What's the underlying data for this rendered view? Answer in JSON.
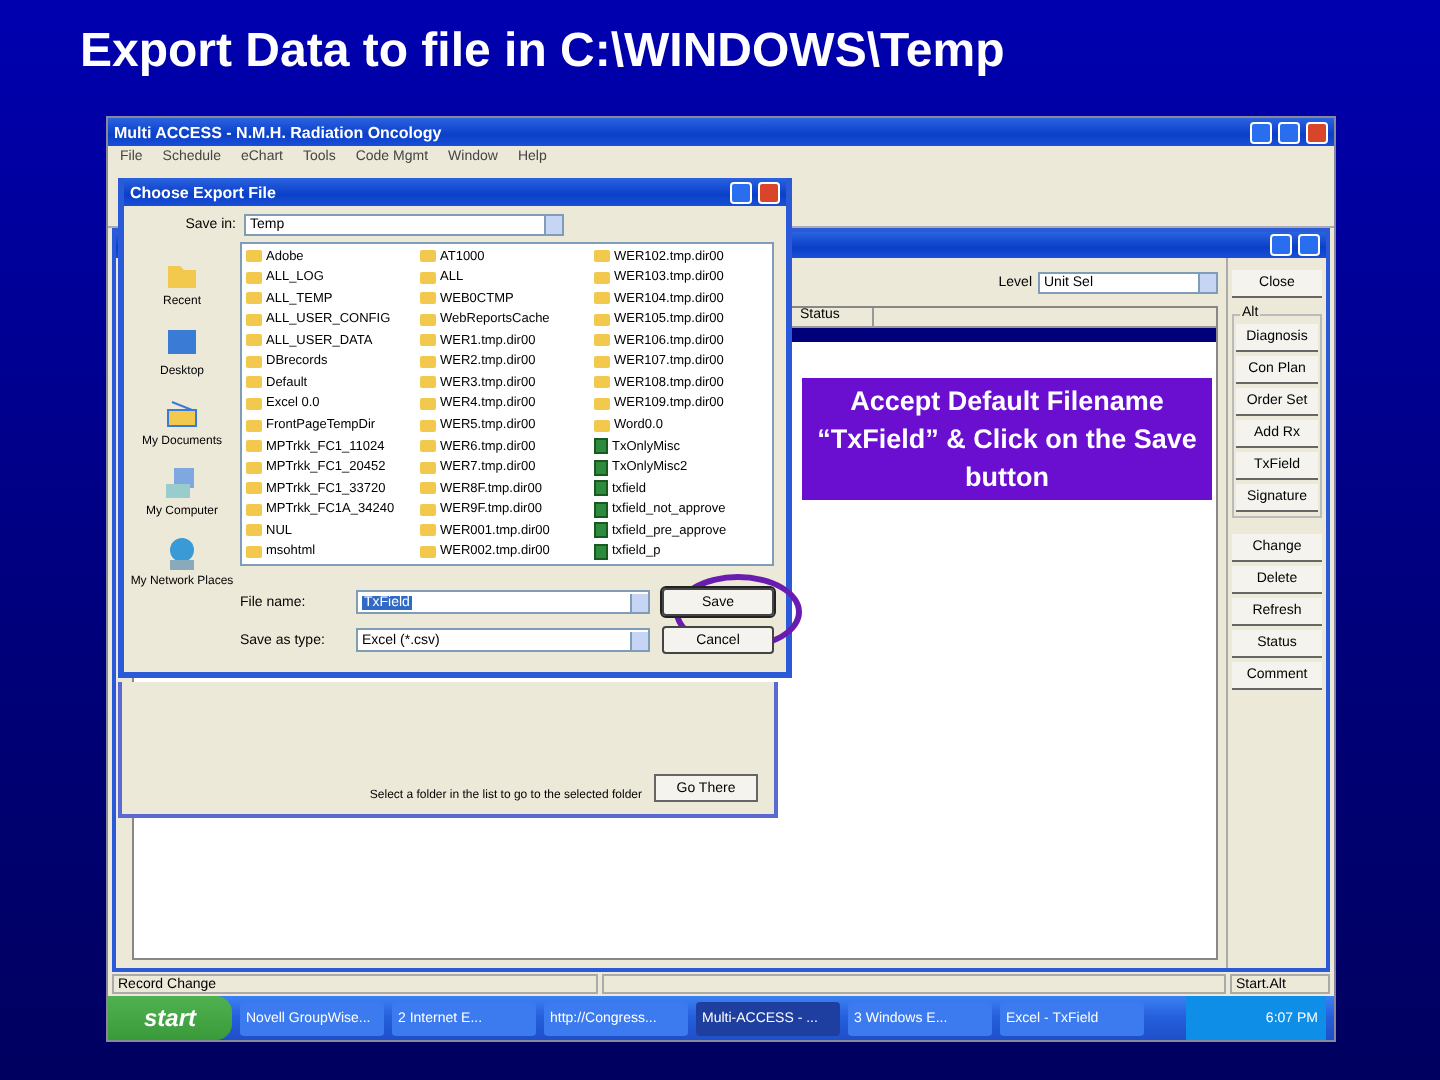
{
  "slide_title": "Export Data to file in C:\\WINDOWS\\Temp",
  "app": {
    "title": "Multi ACCESS - N.M.H. Radiation Oncology",
    "menu": [
      "File",
      "Schedule",
      "eChart",
      "Tools",
      "Code Mgmt",
      "Window",
      "Help"
    ]
  },
  "child": {
    "level_label": "Level",
    "level_value": "Unit Sel",
    "columns": [
      "Status"
    ],
    "side_groups": [
      {
        "buttons": [
          "Close"
        ]
      },
      {
        "label": "Alt",
        "buttons": [
          "Diagnosis",
          "Con Plan",
          "Order Set",
          "Add Rx",
          "TxField",
          "Signature"
        ]
      },
      {
        "buttons": [
          "Change",
          "Delete",
          "Refresh",
          "Status",
          "Comment"
        ]
      }
    ],
    "note": "Select a folder in the list to go to the selected folder",
    "go_there": "Go There"
  },
  "dialog": {
    "title": "Choose Export File",
    "save_in_label": "Save in:",
    "save_in": "Temp",
    "places": [
      {
        "label": "Recent",
        "kind": "recent"
      },
      {
        "label": "Desktop",
        "kind": "desktop"
      },
      {
        "label": "My Documents",
        "kind": "documents"
      },
      {
        "label": "My Computer",
        "kind": "computer"
      },
      {
        "label": "My Network Places",
        "kind": "network"
      }
    ],
    "files": [
      {
        "name": "Adobe",
        "kind": "folder"
      },
      {
        "name": "ALL_LOG",
        "kind": "folder"
      },
      {
        "name": "ALL_TEMP",
        "kind": "folder"
      },
      {
        "name": "ALL_USER_CONFIG",
        "kind": "folder"
      },
      {
        "name": "ALL_USER_DATA",
        "kind": "folder"
      },
      {
        "name": "DBrecords",
        "kind": "folder"
      },
      {
        "name": "Default",
        "kind": "folder"
      },
      {
        "name": "Excel 0.0",
        "kind": "folder"
      },
      {
        "name": "FrontPageTempDir",
        "kind": "folder"
      },
      {
        "name": "MPTrkk_FC1_11024",
        "kind": "folder"
      },
      {
        "name": "MPTrkk_FC1_20452",
        "kind": "folder"
      },
      {
        "name": "MPTrkk_FC1_33720",
        "kind": "folder"
      },
      {
        "name": "MPTrkk_FC1A_34240",
        "kind": "folder"
      },
      {
        "name": "NUL",
        "kind": "folder"
      },
      {
        "name": "msohtml",
        "kind": "folder"
      },
      {
        "name": "AT1000",
        "kind": "folder"
      },
      {
        "name": "ALL",
        "kind": "folder"
      },
      {
        "name": "WEB0CTMP",
        "kind": "folder"
      },
      {
        "name": "WebReportsCache",
        "kind": "folder"
      },
      {
        "name": "WER1.tmp.dir00",
        "kind": "folder"
      },
      {
        "name": "WER2.tmp.dir00",
        "kind": "folder"
      },
      {
        "name": "WER3.tmp.dir00",
        "kind": "folder"
      },
      {
        "name": "WER4.tmp.dir00",
        "kind": "folder"
      },
      {
        "name": "WER5.tmp.dir00",
        "kind": "folder"
      },
      {
        "name": "WER6.tmp.dir00",
        "kind": "folder"
      },
      {
        "name": "WER7.tmp.dir00",
        "kind": "folder"
      },
      {
        "name": "WER8F.tmp.dir00",
        "kind": "folder"
      },
      {
        "name": "WER9F.tmp.dir00",
        "kind": "folder"
      },
      {
        "name": "WER001.tmp.dir00",
        "kind": "folder"
      },
      {
        "name": "WER002.tmp.dir00",
        "kind": "folder"
      },
      {
        "name": "WER102.tmp.dir00",
        "kind": "folder"
      },
      {
        "name": "WER103.tmp.dir00",
        "kind": "folder"
      },
      {
        "name": "WER104.tmp.dir00",
        "kind": "folder"
      },
      {
        "name": "WER105.tmp.dir00",
        "kind": "folder"
      },
      {
        "name": "WER106.tmp.dir00",
        "kind": "folder"
      },
      {
        "name": "WER107.tmp.dir00",
        "kind": "folder"
      },
      {
        "name": "WER108.tmp.dir00",
        "kind": "folder"
      },
      {
        "name": "WER109.tmp.dir00",
        "kind": "folder"
      },
      {
        "name": "Word0.0",
        "kind": "folder"
      },
      {
        "name": "TxOnlyMisc",
        "kind": "sheet"
      },
      {
        "name": "TxOnlyMisc2",
        "kind": "sheet"
      },
      {
        "name": "txfield",
        "kind": "sheet"
      },
      {
        "name": "txfield_not_approve",
        "kind": "sheet"
      },
      {
        "name": "txfield_pre_approve",
        "kind": "sheet"
      },
      {
        "name": "txfield_p",
        "kind": "sheet"
      }
    ],
    "file_name_label": "File name:",
    "file_name": "TxField",
    "type_label": "Save as type:",
    "type": "Excel (*.csv)",
    "buttons": [
      {
        "label": "Save",
        "highlighted": true
      },
      {
        "label": "Cancel",
        "highlighted": false
      }
    ]
  },
  "callout": "Accept Default Filename “TxField” & Click on the Save button",
  "status_bar": [
    "Record Change",
    "Start.Alt"
  ],
  "taskbar": {
    "start": "start",
    "items": [
      {
        "label": "Novell GroupWise...",
        "selected": false
      },
      {
        "label": "2 Internet E...",
        "selected": false
      },
      {
        "label": "http://Congress...",
        "selected": false
      },
      {
        "label": "Multi-ACCESS - ...",
        "selected": true
      },
      {
        "label": "3 Windows E...",
        "selected": false
      },
      {
        "label": "Excel - TxField",
        "selected": false
      }
    ],
    "clock": "6:07 PM"
  }
}
